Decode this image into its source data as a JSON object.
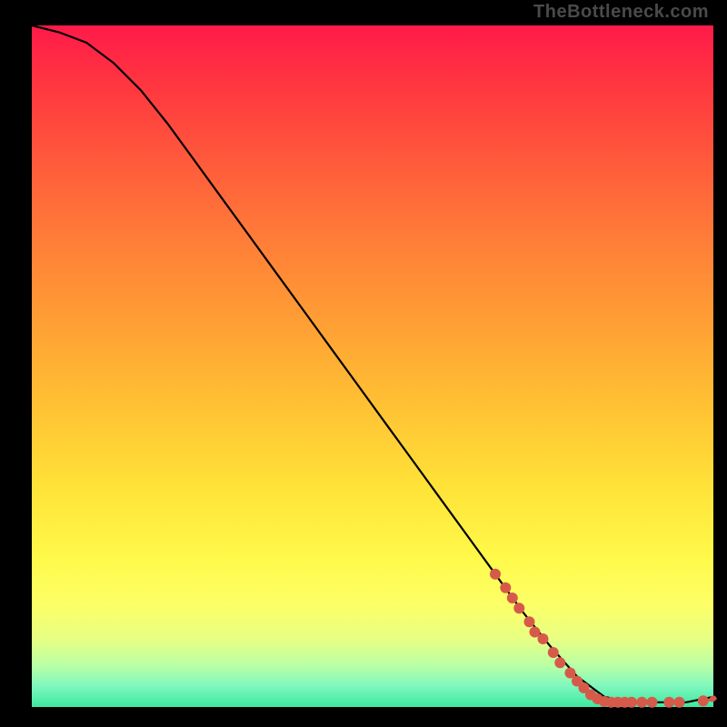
{
  "attribution": "TheBottleneck.com",
  "colors": {
    "marker": "#d65a4a",
    "curve": "#000000",
    "background_top": "#ff1a49",
    "background_bottom": "#3de89f",
    "frame": "#000000"
  },
  "chart_data": {
    "type": "line",
    "title": "",
    "xlabel": "",
    "ylabel": "",
    "xlim": [
      0,
      100
    ],
    "ylim": [
      0,
      100
    ],
    "grid": false,
    "legend": false,
    "series": [
      {
        "name": "curve",
        "x": [
          0,
          4,
          8,
          12,
          16,
          20,
          24,
          28,
          32,
          36,
          40,
          44,
          48,
          52,
          56,
          60,
          64,
          68,
          72,
          76,
          80,
          84,
          88,
          92,
          96,
          100
        ],
        "y": [
          100,
          99,
          97.5,
          94.5,
          90.5,
          85.5,
          80,
          74.5,
          69,
          63.5,
          58,
          52.5,
          47,
          41.5,
          36,
          30.5,
          25,
          19.5,
          14,
          9,
          4.5,
          1.5,
          0.7,
          0.7,
          0.7,
          1.5
        ]
      }
    ],
    "markers": [
      {
        "x": 68.0,
        "y": 19.5
      },
      {
        "x": 69.5,
        "y": 17.5
      },
      {
        "x": 70.5,
        "y": 16.0
      },
      {
        "x": 71.5,
        "y": 14.5
      },
      {
        "x": 73.0,
        "y": 12.5
      },
      {
        "x": 73.8,
        "y": 11.0
      },
      {
        "x": 75.0,
        "y": 10.0
      },
      {
        "x": 76.5,
        "y": 8.0
      },
      {
        "x": 77.5,
        "y": 6.5
      },
      {
        "x": 79.0,
        "y": 5.0
      },
      {
        "x": 80.0,
        "y": 3.8
      },
      {
        "x": 81.0,
        "y": 2.8
      },
      {
        "x": 82.0,
        "y": 1.8
      },
      {
        "x": 83.0,
        "y": 1.2
      },
      {
        "x": 84.0,
        "y": 0.8
      },
      {
        "x": 85.0,
        "y": 0.7
      },
      {
        "x": 86.0,
        "y": 0.7
      },
      {
        "x": 87.0,
        "y": 0.7
      },
      {
        "x": 88.0,
        "y": 0.7
      },
      {
        "x": 89.5,
        "y": 0.7
      },
      {
        "x": 91.0,
        "y": 0.7
      },
      {
        "x": 93.5,
        "y": 0.7
      },
      {
        "x": 95.0,
        "y": 0.7
      },
      {
        "x": 98.5,
        "y": 0.9
      }
    ]
  }
}
